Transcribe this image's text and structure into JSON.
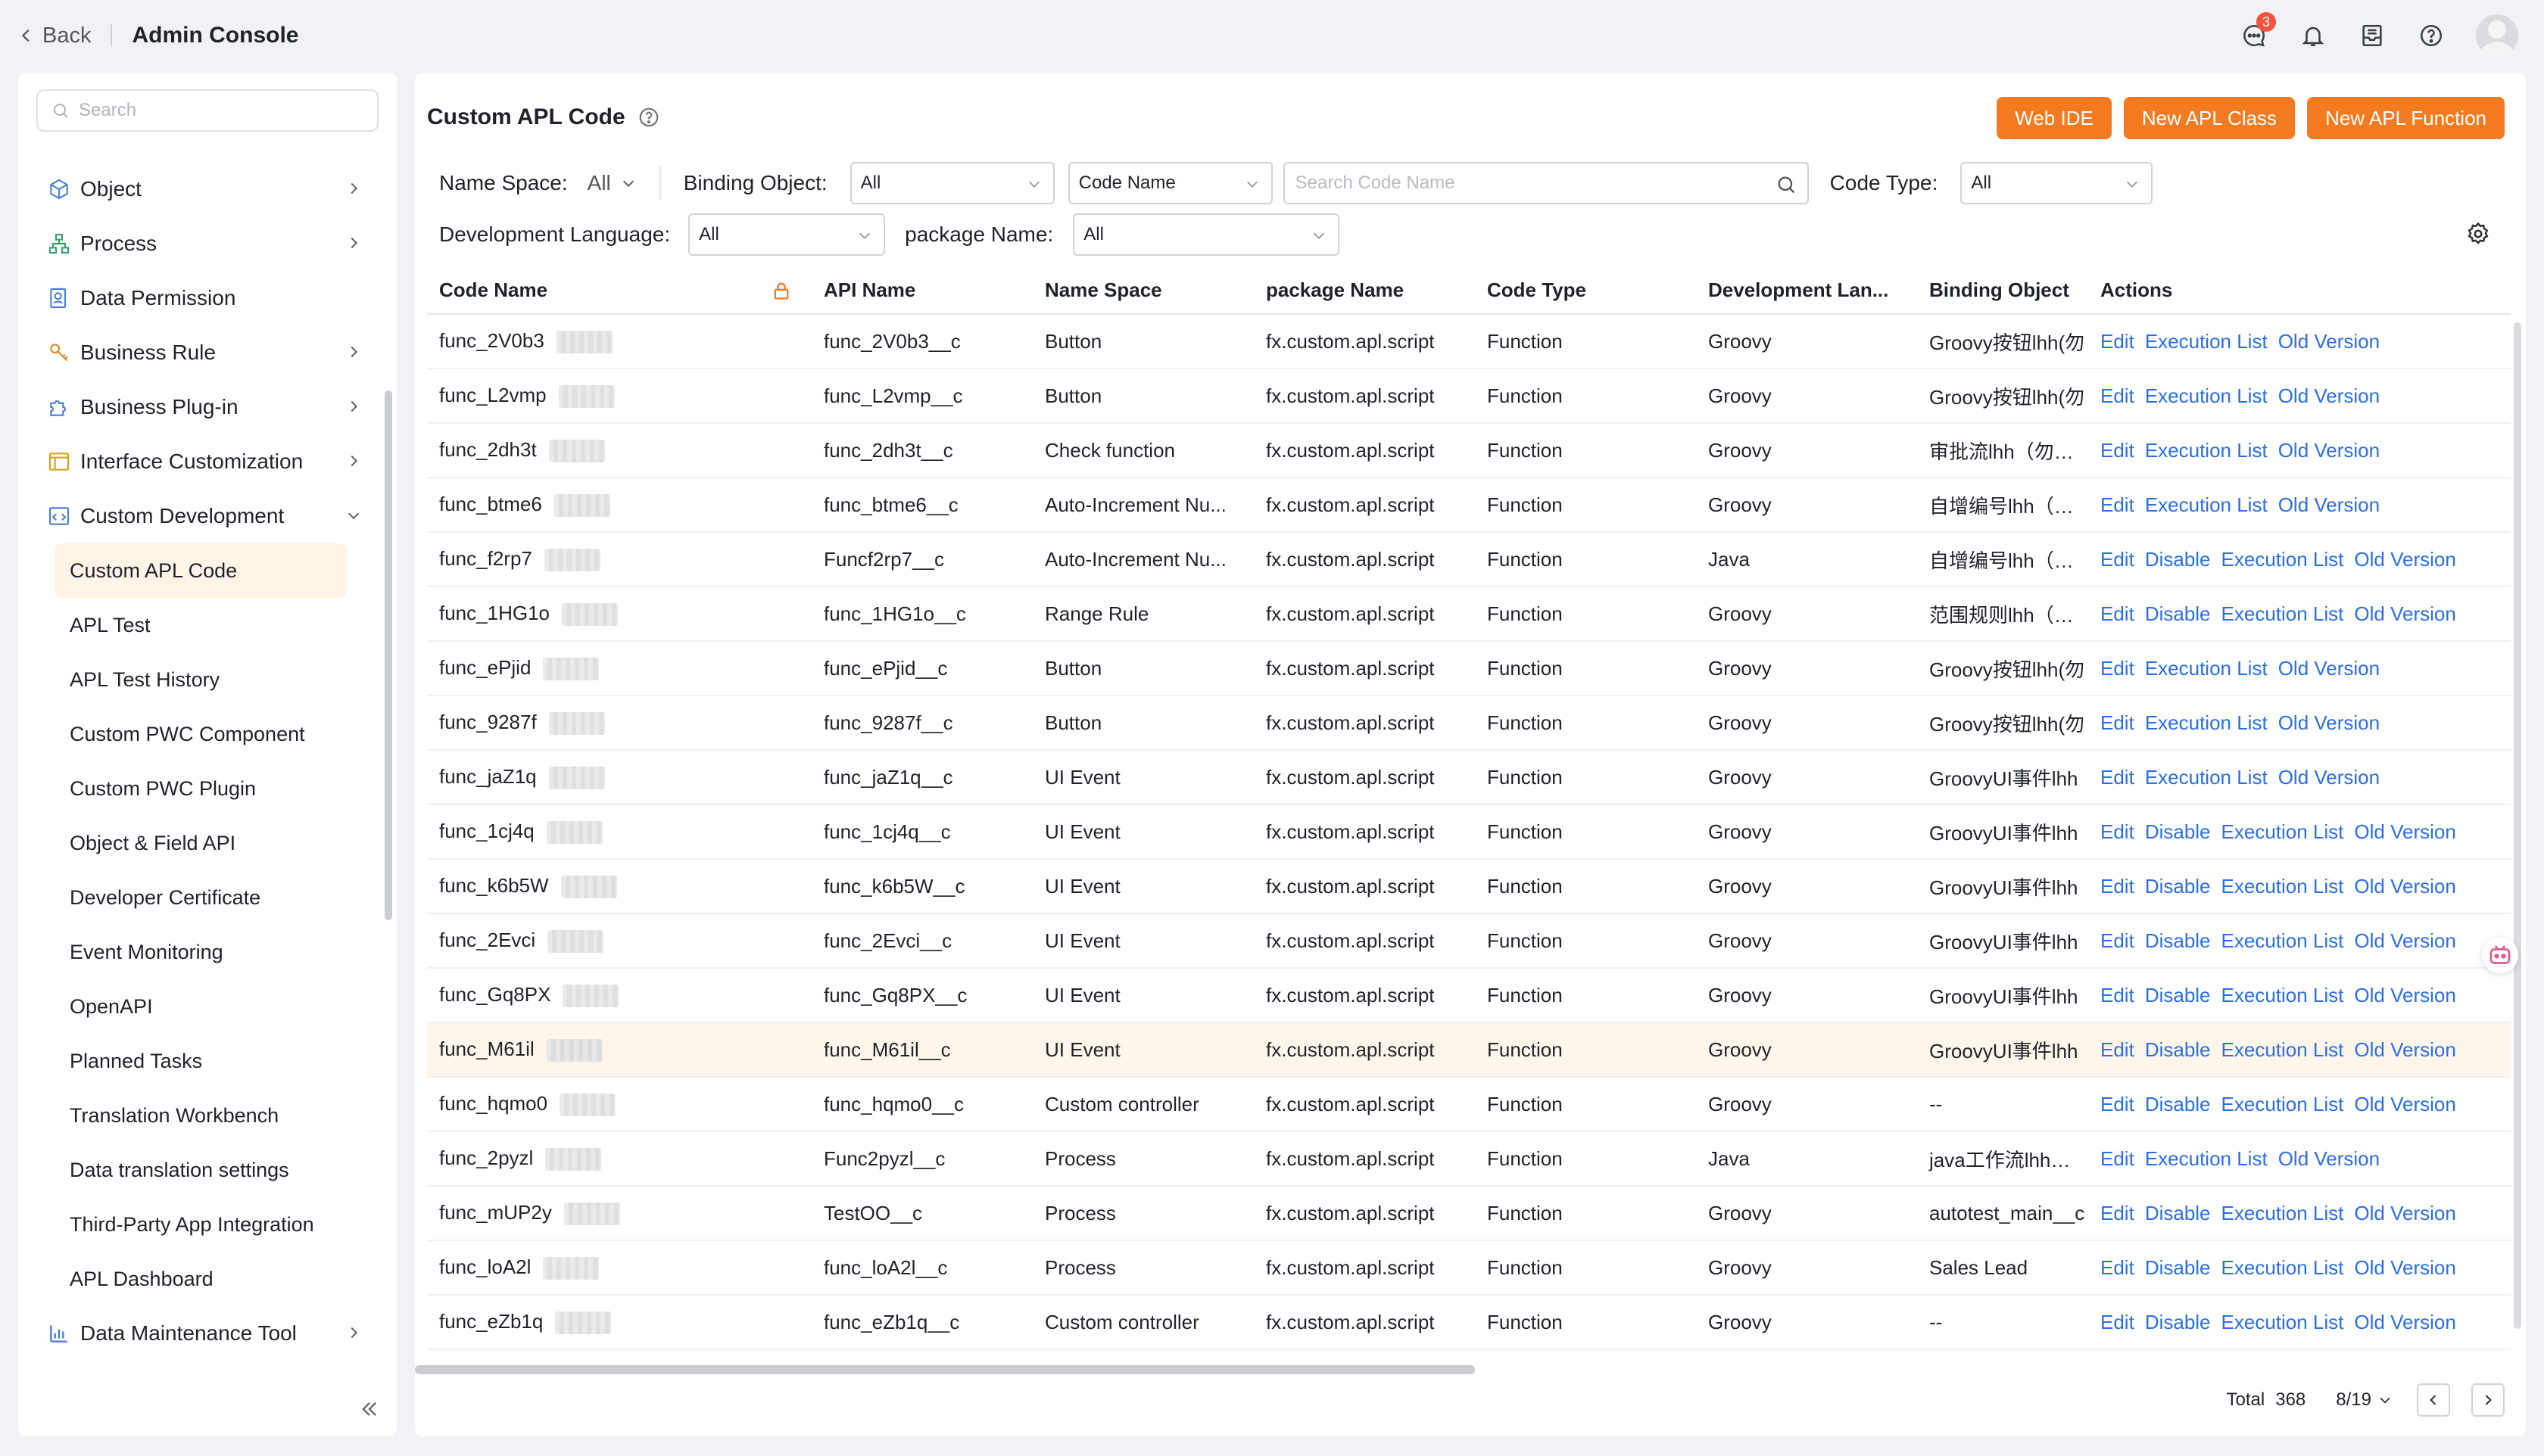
{
  "header": {
    "back_label": "Back",
    "title": "Admin Console",
    "message_badge": "3"
  },
  "sidebar": {
    "search_placeholder": "Search",
    "items": [
      {
        "label": "Object",
        "icon": "cube-icon",
        "expandable": true
      },
      {
        "label": "Process",
        "icon": "flow-icon",
        "expandable": true
      },
      {
        "label": "Data Permission",
        "icon": "permission-icon",
        "expandable": false
      },
      {
        "label": "Business Rule",
        "icon": "rule-icon",
        "expandable": true
      },
      {
        "label": "Business Plug-in",
        "icon": "puzzle-icon",
        "expandable": true
      },
      {
        "label": "Interface Customization",
        "icon": "interface-icon",
        "expandable": true
      },
      {
        "label": "Custom Development",
        "icon": "code-icon",
        "expandable": true,
        "expanded": true
      }
    ],
    "subitems": [
      "Custom APL Code",
      "APL Test",
      "APL Test History",
      "Custom PWC Component",
      "Custom PWC Plugin",
      "Object & Field API",
      "Developer Certificate",
      "Event Monitoring",
      "OpenAPI",
      "Planned Tasks",
      "Translation Workbench",
      "Data translation settings",
      "Third-Party App Integration",
      "APL Dashboard"
    ],
    "active_subitem": "Custom APL Code",
    "last_item": {
      "label": "Data Maintenance Tool",
      "icon": "chart-icon"
    }
  },
  "main": {
    "title": "Custom APL Code",
    "buttons": {
      "web_ide": "Web IDE",
      "new_class": "New APL Class",
      "new_function": "New APL Function"
    },
    "filters": {
      "namespace_label": "Name Space:",
      "namespace_value": "All",
      "binding_label": "Binding Object:",
      "binding_value": "All",
      "search_field": "Code Name",
      "search_placeholder": "Search Code Name",
      "code_type_label": "Code Type:",
      "code_type_value": "All",
      "dev_lang_label": "Development Language:",
      "dev_lang_value": "All",
      "package_label": "package Name:",
      "package_value": "All"
    },
    "columns": [
      "Code Name",
      "API Name",
      "Name Space",
      "package Name",
      "Code Type",
      "Development Lan...",
      "Binding Object",
      "Actions"
    ],
    "rows": [
      {
        "code": "func_2V0b3",
        "api": "func_2V0b3__c",
        "ns": "Button",
        "pkg": "fx.custom.apl.script",
        "type": "Function",
        "lang": "Groovy",
        "binding": "Groovy按钮lhh(勿",
        "actions": [
          "Edit",
          "Execution List",
          "Old Version"
        ]
      },
      {
        "code": "func_L2vmp",
        "api": "func_L2vmp__c",
        "ns": "Button",
        "pkg": "fx.custom.apl.script",
        "type": "Function",
        "lang": "Groovy",
        "binding": "Groovy按钮lhh(勿",
        "actions": [
          "Edit",
          "Execution List",
          "Old Version"
        ]
      },
      {
        "code": "func_2dh3t",
        "api": "func_2dh3t__c",
        "ns": "Check function",
        "pkg": "fx.custom.apl.script",
        "type": "Function",
        "lang": "Groovy",
        "binding": "审批流lhh（勿动）",
        "actions": [
          "Edit",
          "Execution List",
          "Old Version"
        ]
      },
      {
        "code": "func_btme6",
        "api": "func_btme6__c",
        "ns": "Auto-Increment Nu...",
        "pkg": "fx.custom.apl.script",
        "type": "Function",
        "lang": "Groovy",
        "binding": "自增编号lhh（勿动",
        "actions": [
          "Edit",
          "Execution List",
          "Old Version"
        ]
      },
      {
        "code": "func_f2rp7",
        "api": "Funcf2rp7__c",
        "ns": "Auto-Increment Nu...",
        "pkg": "fx.custom.apl.script",
        "type": "Function",
        "lang": "Java",
        "binding": "自增编号lhh（勿动",
        "actions": [
          "Edit",
          "Disable",
          "Execution List",
          "Old Version"
        ]
      },
      {
        "code": "func_1HG1o",
        "api": "func_1HG1o__c",
        "ns": "Range Rule",
        "pkg": "fx.custom.apl.script",
        "type": "Function",
        "lang": "Groovy",
        "binding": "范围规则lhh（勿动",
        "actions": [
          "Edit",
          "Disable",
          "Execution List",
          "Old Version"
        ]
      },
      {
        "code": "func_ePjid",
        "api": "func_ePjid__c",
        "ns": "Button",
        "pkg": "fx.custom.apl.script",
        "type": "Function",
        "lang": "Groovy",
        "binding": "Groovy按钮lhh(勿",
        "actions": [
          "Edit",
          "Execution List",
          "Old Version"
        ]
      },
      {
        "code": "func_9287f",
        "api": "func_9287f__c",
        "ns": "Button",
        "pkg": "fx.custom.apl.script",
        "type": "Function",
        "lang": "Groovy",
        "binding": "Groovy按钮lhh(勿",
        "actions": [
          "Edit",
          "Execution List",
          "Old Version"
        ]
      },
      {
        "code": "func_jaZ1q",
        "api": "func_jaZ1q__c",
        "ns": "UI Event",
        "pkg": "fx.custom.apl.script",
        "type": "Function",
        "lang": "Groovy",
        "binding": "GroovyUI事件lhh",
        "actions": [
          "Edit",
          "Execution List",
          "Old Version"
        ]
      },
      {
        "code": "func_1cj4q",
        "api": "func_1cj4q__c",
        "ns": "UI Event",
        "pkg": "fx.custom.apl.script",
        "type": "Function",
        "lang": "Groovy",
        "binding": "GroovyUI事件lhh",
        "actions": [
          "Edit",
          "Disable",
          "Execution List",
          "Old Version"
        ]
      },
      {
        "code": "func_k6b5W",
        "api": "func_k6b5W__c",
        "ns": "UI Event",
        "pkg": "fx.custom.apl.script",
        "type": "Function",
        "lang": "Groovy",
        "binding": "GroovyUI事件lhh",
        "actions": [
          "Edit",
          "Disable",
          "Execution List",
          "Old Version"
        ]
      },
      {
        "code": "func_2Evci",
        "api": "func_2Evci__c",
        "ns": "UI Event",
        "pkg": "fx.custom.apl.script",
        "type": "Function",
        "lang": "Groovy",
        "binding": "GroovyUI事件lhh",
        "actions": [
          "Edit",
          "Disable",
          "Execution List",
          "Old Version"
        ]
      },
      {
        "code": "func_Gq8PX",
        "api": "func_Gq8PX__c",
        "ns": "UI Event",
        "pkg": "fx.custom.apl.script",
        "type": "Function",
        "lang": "Groovy",
        "binding": "GroovyUI事件lhh",
        "actions": [
          "Edit",
          "Disable",
          "Execution List",
          "Old Version"
        ]
      },
      {
        "code": "func_M61il",
        "api": "func_M61il__c",
        "ns": "UI Event",
        "pkg": "fx.custom.apl.script",
        "type": "Function",
        "lang": "Groovy",
        "binding": "GroovyUI事件lhh",
        "actions": [
          "Edit",
          "Disable",
          "Execution List",
          "Old Version"
        ],
        "highlight": true
      },
      {
        "code": "func_hqmo0",
        "api": "func_hqmo0__c",
        "ns": "Custom controller",
        "pkg": "fx.custom.apl.script",
        "type": "Function",
        "lang": "Groovy",
        "binding": "--",
        "actions": [
          "Edit",
          "Disable",
          "Execution List",
          "Old Version"
        ]
      },
      {
        "code": "func_2pyzl",
        "api": "Func2pyzl__c",
        "ns": "Process",
        "pkg": "fx.custom.apl.script",
        "type": "Function",
        "lang": "Java",
        "binding": "java工作流lhh（勿",
        "actions": [
          "Edit",
          "Execution List",
          "Old Version"
        ]
      },
      {
        "code": "func_mUP2y",
        "api": "TestOO__c",
        "ns": "Process",
        "pkg": "fx.custom.apl.script",
        "type": "Function",
        "lang": "Groovy",
        "binding": "autotest_main__c",
        "actions": [
          "Edit",
          "Disable",
          "Execution List",
          "Old Version"
        ]
      },
      {
        "code": "func_loA2l",
        "api": "func_loA2l__c",
        "ns": "Process",
        "pkg": "fx.custom.apl.script",
        "type": "Function",
        "lang": "Groovy",
        "binding": "Sales Lead",
        "actions": [
          "Edit",
          "Disable",
          "Execution List",
          "Old Version"
        ]
      },
      {
        "code": "func_eZb1q",
        "api": "func_eZb1q__c",
        "ns": "Custom controller",
        "pkg": "fx.custom.apl.script",
        "type": "Function",
        "lang": "Groovy",
        "binding": "--",
        "actions": [
          "Edit",
          "Disable",
          "Execution List",
          "Old Version"
        ]
      }
    ],
    "pager": {
      "total_label": "Total",
      "total": "368",
      "page": "8/19"
    }
  },
  "colors": {
    "accent": "#f57b20",
    "link": "#2a6ee8",
    "active_bg": "#fff4e6"
  }
}
